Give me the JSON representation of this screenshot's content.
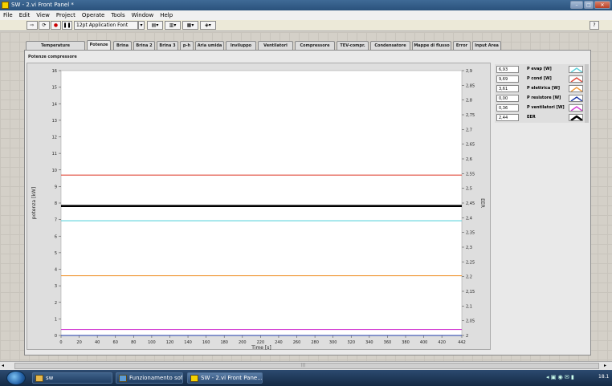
{
  "window": {
    "title": "SW - 2.vi Front Panel *",
    "buttons": [
      "–",
      "□",
      "✕"
    ]
  },
  "menu": [
    "File",
    "Edit",
    "View",
    "Project",
    "Operate",
    "Tools",
    "Window",
    "Help"
  ],
  "toolbar": {
    "font": "12pt Application Font",
    "help": "?"
  },
  "tabs": [
    "Temperature compressore",
    "Potenze",
    "Brina",
    "Brina 2",
    "Brina 3",
    "p-h",
    "Aria umida",
    "Inviluppo",
    "Ventilatori",
    "Compressore",
    "TEV-compr.",
    "Condensatore",
    "Mappe di flusso",
    "Error",
    "Input Area"
  ],
  "active_tab": "Potenze",
  "chart_title": "Potenze compressore",
  "legend": [
    {
      "value": "6,93",
      "name": "P evap [W]",
      "color": "#5fd3dc"
    },
    {
      "value": "9,69",
      "name": "P cond [W]",
      "color": "#e04a3a"
    },
    {
      "value": "3,61",
      "name": "P elettrica  [W]",
      "color": "#f09a3c"
    },
    {
      "value": "0,00",
      "name": "P resistore [W]",
      "color": "#1f3aa8"
    },
    {
      "value": "0,36",
      "name": "P ventilatori [W]",
      "color": "#d23cd2"
    },
    {
      "value": "2,44",
      "name": "EER",
      "color": "#000000"
    }
  ],
  "chart_data": {
    "type": "line",
    "title": "",
    "xlabel": "Time [s]",
    "ylabel": "potenza [kW]",
    "y2label": "EER",
    "xlim": [
      0,
      442
    ],
    "ylim": [
      0,
      16
    ],
    "y2lim": [
      2,
      2.9
    ],
    "xticks": [
      "0",
      "20",
      "40",
      "60",
      "80",
      "100",
      "120",
      "140",
      "160",
      "180",
      "200",
      "220",
      "240",
      "260",
      "280",
      "300",
      "320",
      "340",
      "360",
      "380",
      "400",
      "420",
      "442"
    ],
    "xtick_values": [
      0,
      20,
      40,
      60,
      80,
      100,
      120,
      140,
      160,
      180,
      200,
      220,
      240,
      260,
      280,
      300,
      320,
      340,
      360,
      380,
      400,
      420,
      442
    ],
    "yticks": [
      "0",
      "1",
      "2",
      "3",
      "4",
      "5",
      "6",
      "7",
      "8",
      "9",
      "10",
      "11",
      "12",
      "13",
      "14",
      "15",
      "16"
    ],
    "y2ticks": [
      "2",
      "2,05",
      "2,1",
      "2,15",
      "2,2",
      "2,25",
      "2,3",
      "2,35",
      "2,4",
      "2,45",
      "2,5",
      "2,55",
      "2,6",
      "2,65",
      "2,7",
      "2,75",
      "2,8",
      "2,85",
      "2,9"
    ],
    "series": [
      {
        "name": "P evap [W]",
        "color": "#5fd3dc",
        "axis": "left",
        "x": [
          0,
          442
        ],
        "y": [
          6.93,
          6.93
        ]
      },
      {
        "name": "P cond [W]",
        "color": "#e04a3a",
        "axis": "left",
        "x": [
          0,
          442
        ],
        "y": [
          9.69,
          9.69
        ]
      },
      {
        "name": "P elettrica  [W]",
        "color": "#f09a3c",
        "axis": "left",
        "x": [
          0,
          442
        ],
        "y": [
          3.61,
          3.61
        ]
      },
      {
        "name": "P resistore [W]",
        "color": "#1f3aa8",
        "axis": "left",
        "x": [
          0,
          442
        ],
        "y": [
          0.0,
          0.0
        ]
      },
      {
        "name": "P ventilatori [W]",
        "color": "#d23cd2",
        "axis": "left",
        "x": [
          0,
          442
        ],
        "y": [
          0.36,
          0.36
        ]
      },
      {
        "name": "EER",
        "color": "#000000",
        "axis": "right",
        "x": [
          0,
          442
        ],
        "y": [
          2.44,
          2.44
        ]
      }
    ]
  },
  "scroll": {
    "marker": "|||"
  },
  "taskbar": {
    "items": [
      "sw",
      "Funzionamento soft...",
      "SW - 2.vi Front Pane..."
    ],
    "tray": "18.1"
  }
}
